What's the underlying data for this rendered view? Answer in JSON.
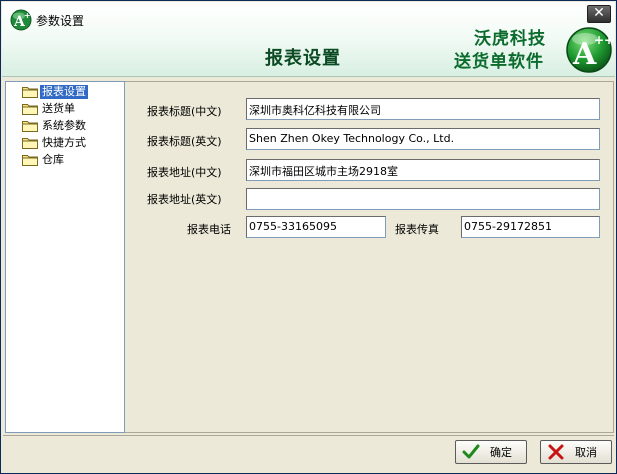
{
  "window": {
    "title": "参数设置",
    "close_symbol": "✕"
  },
  "header": {
    "heading": "报表设置",
    "brand_line1": "沃虎科技",
    "brand_line2": "送货单软件",
    "logo_letter": "A",
    "logo_sup": "++",
    "small_logo_letter": "A",
    "small_logo_sup": "+"
  },
  "tree": {
    "items": [
      {
        "label": "报表设置",
        "selected": true,
        "icon": "folder-icon"
      },
      {
        "label": "送货单",
        "selected": false,
        "icon": "folder-icon"
      },
      {
        "label": "系统参数",
        "selected": false,
        "icon": "folder-icon"
      },
      {
        "label": "快捷方式",
        "selected": false,
        "icon": "folder-icon"
      },
      {
        "label": "仓库",
        "selected": false,
        "icon": "folder-icon"
      }
    ]
  },
  "form": {
    "title_cn_label": "报表标题(中文)",
    "title_cn_value": "深圳市奥科亿科技有限公司",
    "title_en_label": "报表标题(英文)",
    "title_en_value": "Shen Zhen Okey Technology Co., Ltd.",
    "addr_cn_label": "报表地址(中文)",
    "addr_cn_value": "深圳市福田区城市主场2918室",
    "addr_en_label": "报表地址(英文)",
    "addr_en_value": "",
    "phone_label": "报表电话",
    "phone_value": "0755-33165095",
    "fax_label": "报表传真",
    "fax_value": "0755-29172851"
  },
  "buttons": {
    "ok_label": "确定",
    "cancel_label": "取消"
  },
  "colors": {
    "accent_green": "#0b6b2d",
    "tree_selected": "#316ac5"
  }
}
